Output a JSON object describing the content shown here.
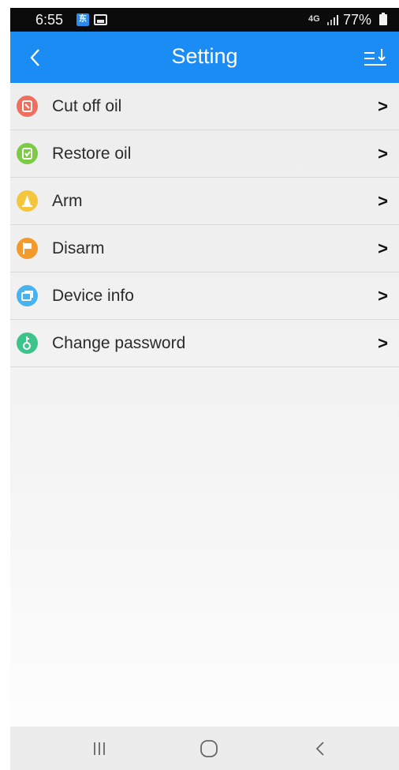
{
  "status_bar": {
    "time": "6:55",
    "network": "4G",
    "battery": "77%"
  },
  "header": {
    "title": "Setting",
    "back_icon": "chevron-left-icon",
    "sort_icon": "sort-down-icon"
  },
  "menu": {
    "items": [
      {
        "label": "Cut off oil",
        "icon": "cut-oil-icon",
        "color": "#ef6f5e"
      },
      {
        "label": "Restore oil",
        "icon": "restore-oil-icon",
        "color": "#7dcb45"
      },
      {
        "label": "Arm",
        "icon": "arm-icon",
        "color": "#f4c63c"
      },
      {
        "label": "Disarm",
        "icon": "flag-icon",
        "color": "#f39a2c"
      },
      {
        "label": "Device info",
        "icon": "device-info-icon",
        "color": "#49b3ef"
      },
      {
        "label": "Change password",
        "icon": "key-icon",
        "color": "#3dc48b"
      }
    ],
    "chevron": ">"
  },
  "nav_bar": {
    "recent_icon": "recent-apps-icon",
    "home_icon": "home-icon",
    "back_icon": "back-icon"
  },
  "colors": {
    "header": "#1a8cf3",
    "status_bar": "#0b0b0b"
  }
}
